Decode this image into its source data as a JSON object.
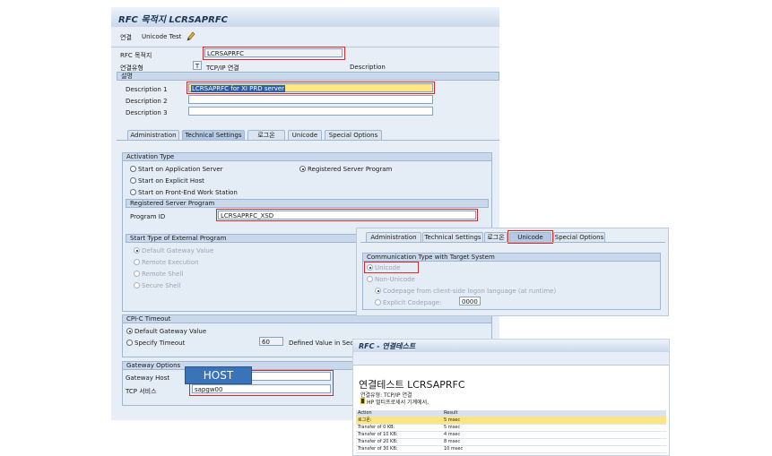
{
  "main": {
    "title": "RFC 목적지 LCRSAPRFC",
    "toolbar": {
      "connect": "연결",
      "unicode_test": "Unicode Test"
    },
    "rfc_label": "RFC 목적지",
    "rfc_value": "LCRSAPRFC",
    "conn_type_label": "연결유형",
    "conn_type_code": "T",
    "conn_type_value": "TCP/IP 연결",
    "description_caption": "Description",
    "section_desc": "설명",
    "desc1_label": "Description 1",
    "desc1_value": "LCRSAPRFC for XI PRD server",
    "desc2_label": "Description 2",
    "desc3_label": "Description 3",
    "tabs": [
      "Administration",
      "Technical Settings",
      "로그온",
      "Unicode",
      "Special Options"
    ],
    "activation_type": {
      "title": "Activation Type",
      "opt1": "Start on Application Server",
      "opt2": "Start on Explicit Host",
      "opt3": "Start on Front-End Work Station",
      "opt4": "Registered Server Program"
    },
    "registered": {
      "title": "Registered Server Program",
      "program_id_label": "Program ID",
      "program_id_value": "LCRSAPRFC_XSD"
    },
    "start_type": {
      "title": "Start Type of External Program",
      "opt1": "Default Gateway Value",
      "opt2": "Remote Execution",
      "opt3": "Remote Shell",
      "opt4": "Secure Shell"
    },
    "cpic": {
      "title": "CPI-C Timeout",
      "opt1": "Default Gateway Value",
      "opt2": "Specify Timeout",
      "timeout_value": "60",
      "defined_text": "Defined Value in Seco"
    },
    "gateway": {
      "title": "Gateway Options",
      "host_label": "Gateway Host",
      "service_label": "TCP 서비스",
      "service_value": "sapgw00",
      "host_badge": "HOST"
    }
  },
  "unicode_popup": {
    "tabs": [
      "Administration",
      "Technical Settings",
      "로그온",
      "Unicode",
      "Special Options"
    ],
    "group_title": "Communication Type with Target System",
    "opt_unicode": "Unicode",
    "opt_non_unicode": "Non-Unicode",
    "opt_codepage_client": "Codepage from client-side logon language (at runtime)",
    "opt_explicit_codepage": "Explicit Codepage:",
    "codepage_value": "0000"
  },
  "test_popup": {
    "title": "RFC - 연결테스트",
    "heading": "연결테스트 LCRSAPRFC",
    "conn_type": "연결유형: TCP/IP 연결",
    "host_line": "HP 멀티프로세서 기계에서,",
    "col_action": "Action",
    "col_result": "Result",
    "rows": [
      {
        "action": "로그온:",
        "result": "5 msec"
      },
      {
        "action": "Transfer of 0 KB:",
        "result": "5 msec"
      },
      {
        "action": "Transfer of 10 KB:",
        "result": "4 msec"
      },
      {
        "action": "Transfer of 20 KB:",
        "result": "8 msec"
      },
      {
        "action": "Transfer of 30 KB:",
        "result": "10 msec"
      }
    ]
  },
  "colors": {
    "highlight_red": "#d42a2a",
    "host_badge": "#3b73b9",
    "field_yellow": "#ffe680"
  }
}
